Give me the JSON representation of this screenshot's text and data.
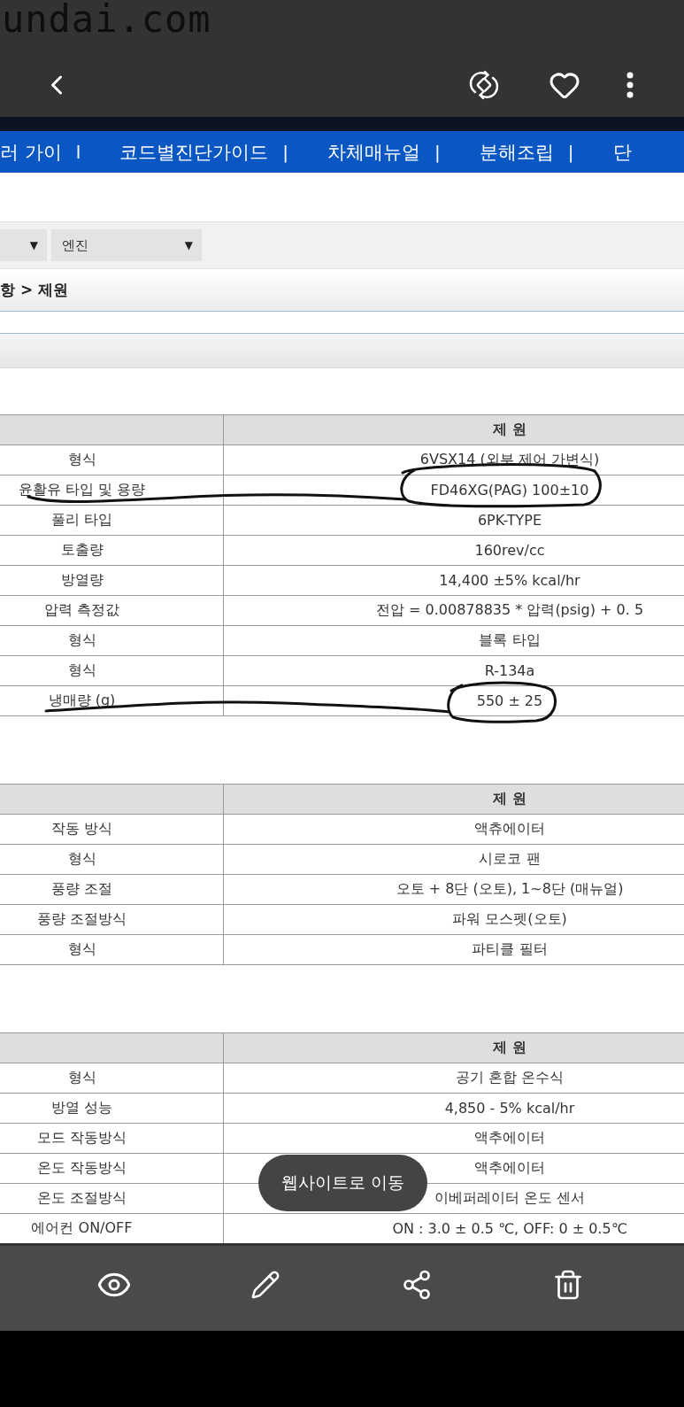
{
  "scribble": {
    "text": "undai.com"
  },
  "toolbar": {
    "buttons": [
      {
        "kind": "back"
      },
      {
        "kind": "rotate"
      },
      {
        "kind": "favorite"
      },
      {
        "kind": "more"
      }
    ]
  },
  "nav": {
    "items": [
      {
        "kind": "link",
        "label": "러 가이"
      },
      {
        "kind": "divider",
        "label": "l"
      },
      {
        "kind": "link",
        "label": "코드별진단가이드"
      },
      {
        "kind": "divider",
        "label": "|"
      },
      {
        "kind": "link",
        "label": "차체매뉴얼"
      },
      {
        "kind": "divider",
        "label": "|"
      },
      {
        "kind": "link",
        "label": "분해조립"
      },
      {
        "kind": "divider",
        "label": "|"
      },
      {
        "kind": "link",
        "label": "단"
      }
    ]
  },
  "filters": [
    {
      "kind": "cut",
      "caret": "▼"
    },
    {
      "kind": "full",
      "value": "엔진",
      "caret": "▼"
    }
  ],
  "breadcrumb": "항 > 제원",
  "tables": [
    {
      "header": "제 원",
      "rows": [
        [
          "형식",
          "6VSX14 (외부 제어 가변식)"
        ],
        [
          "윤활유 타입 및 용량",
          "FD46XG(PAG) 100±10"
        ],
        [
          "풀리 타입",
          "6PK-TYPE"
        ],
        [
          "토출량",
          "160rev/cc"
        ],
        [
          "방열량",
          "14,400 ±5% kcal/hr"
        ],
        [
          "압력 측정값",
          "전압 = 0.00878835 * 압력(psig) + 0. 5"
        ],
        [
          "형식",
          "블록 타입"
        ],
        [
          "형식",
          "R-134a"
        ],
        [
          "냉매량 (g)",
          "550 ± 25"
        ]
      ],
      "annotated": true
    },
    {
      "header": "제 원",
      "rows": [
        [
          "작동 방식",
          "액츄에이터"
        ],
        [
          "형식",
          "시로코 팬"
        ],
        [
          "풍량 조절",
          "오토 + 8단 (오토), 1~8단 (매뉴얼)"
        ],
        [
          "풍량 조절방식",
          "파워 모스펫(오토)"
        ],
        [
          "형식",
          "파티클 필터"
        ]
      ],
      "annotated": false
    },
    {
      "header": "제 원",
      "rows": [
        [
          "형식",
          "공기 혼합 온수식"
        ],
        [
          "방열 성능",
          "4,850 - 5% kcal/hr"
        ],
        [
          "모드 작동방식",
          "액추에이터"
        ],
        [
          "온도 작동방식",
          "액추에이터"
        ],
        [
          "온도 조절방식",
          "이베퍼레이터 온도 센서"
        ],
        [
          "에어컨 ON/OFF",
          "ON : 3.0 ± 0.5 ℃, OFF: 0 ± 0.5℃"
        ]
      ],
      "annotated": false
    }
  ],
  "toast": "웹사이트로 이동",
  "bottom_bar": {
    "buttons": [
      {
        "kind": "view"
      },
      {
        "kind": "edit"
      },
      {
        "kind": "share"
      },
      {
        "kind": "delete"
      }
    ]
  }
}
